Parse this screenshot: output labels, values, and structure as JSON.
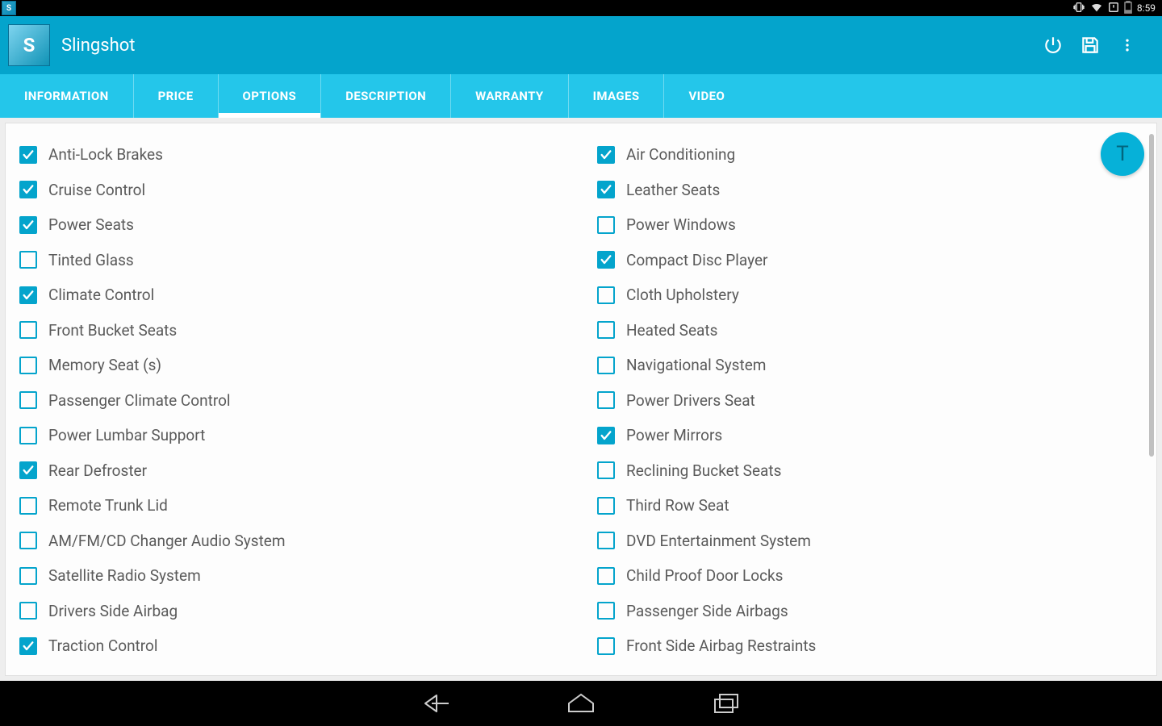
{
  "statusbar": {
    "time": "8:59"
  },
  "actionbar": {
    "title": "Slingshot",
    "app_icon_glyph": "S"
  },
  "tabs": [
    {
      "label": "INFORMATION",
      "active": false
    },
    {
      "label": "PRICE",
      "active": false
    },
    {
      "label": "OPTIONS",
      "active": true
    },
    {
      "label": "DESCRIPTION",
      "active": false
    },
    {
      "label": "WARRANTY",
      "active": false
    },
    {
      "label": "IMAGES",
      "active": false
    },
    {
      "label": "VIDEO",
      "active": false
    }
  ],
  "float_badge": {
    "text": "T"
  },
  "options_left": [
    {
      "label": "Anti-Lock Brakes",
      "checked": true
    },
    {
      "label": "Cruise Control",
      "checked": true
    },
    {
      "label": "Power Seats",
      "checked": true
    },
    {
      "label": "Tinted Glass",
      "checked": false
    },
    {
      "label": "Climate Control",
      "checked": true
    },
    {
      "label": "Front Bucket Seats",
      "checked": false
    },
    {
      "label": "Memory Seat (s)",
      "checked": false
    },
    {
      "label": "Passenger Climate Control",
      "checked": false
    },
    {
      "label": "Power Lumbar Support",
      "checked": false
    },
    {
      "label": "Rear Defroster",
      "checked": true
    },
    {
      "label": "Remote Trunk Lid",
      "checked": false
    },
    {
      "label": "AM/FM/CD Changer Audio System",
      "checked": false
    },
    {
      "label": "Satellite Radio System",
      "checked": false
    },
    {
      "label": "Drivers Side Airbag",
      "checked": false
    },
    {
      "label": "Traction Control",
      "checked": true
    }
  ],
  "options_right": [
    {
      "label": "Air Conditioning",
      "checked": true
    },
    {
      "label": "Leather Seats",
      "checked": true
    },
    {
      "label": "Power Windows",
      "checked": false
    },
    {
      "label": "Compact Disc Player",
      "checked": true
    },
    {
      "label": "Cloth Upholstery",
      "checked": false
    },
    {
      "label": "Heated Seats",
      "checked": false
    },
    {
      "label": "Navigational System",
      "checked": false
    },
    {
      "label": "Power Drivers Seat",
      "checked": false
    },
    {
      "label": "Power Mirrors",
      "checked": true
    },
    {
      "label": "Reclining Bucket Seats",
      "checked": false
    },
    {
      "label": "Third Row Seat",
      "checked": false
    },
    {
      "label": "DVD Entertainment System",
      "checked": false
    },
    {
      "label": "Child Proof Door Locks",
      "checked": false
    },
    {
      "label": "Passenger Side Airbags",
      "checked": false
    },
    {
      "label": "Front Side Airbag Restraints",
      "checked": false
    }
  ]
}
